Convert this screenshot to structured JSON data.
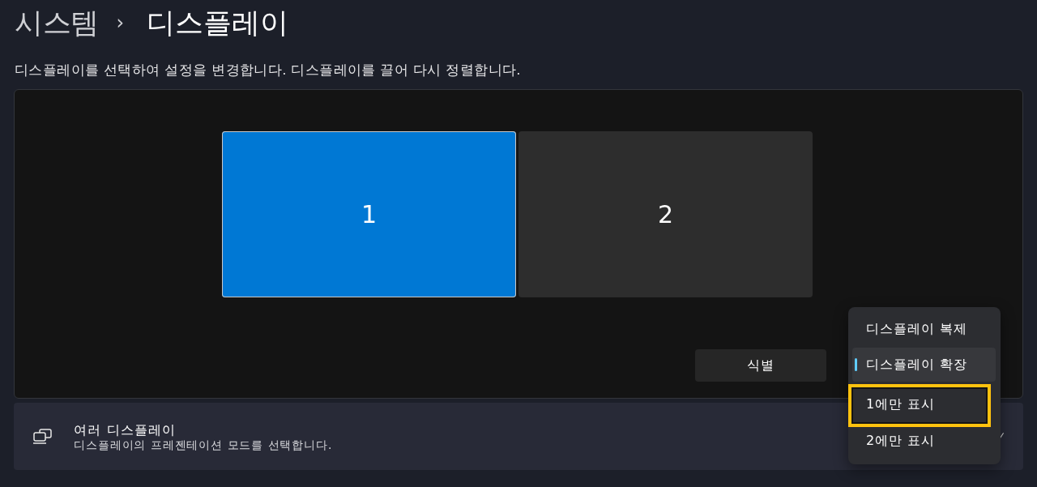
{
  "breadcrumb": {
    "parent": "시스템",
    "separator": "›",
    "current": "디스플레이"
  },
  "description": "디스플레이를 선택하여 설정을 변경합니다. 디스플레이를 끌어 다시 정렬합니다.",
  "arrangement": {
    "displays": [
      {
        "label": "1",
        "selected": true
      },
      {
        "label": "2",
        "selected": false
      }
    ],
    "identify_button": "식별"
  },
  "multiple_displays": {
    "title": "여러 디스플레이",
    "subtitle": "디스플레이의 프레젠테이션 모드를 선택합니다."
  },
  "menu": {
    "options": [
      {
        "label": "디스플레이 복제",
        "selected": false,
        "highlighted": false
      },
      {
        "label": "디스플레이 확장",
        "selected": true,
        "highlighted": false
      },
      {
        "label": "1에만 표시",
        "selected": false,
        "highlighted": true
      },
      {
        "label": "2에만 표시",
        "selected": false,
        "highlighted": false
      }
    ]
  }
}
